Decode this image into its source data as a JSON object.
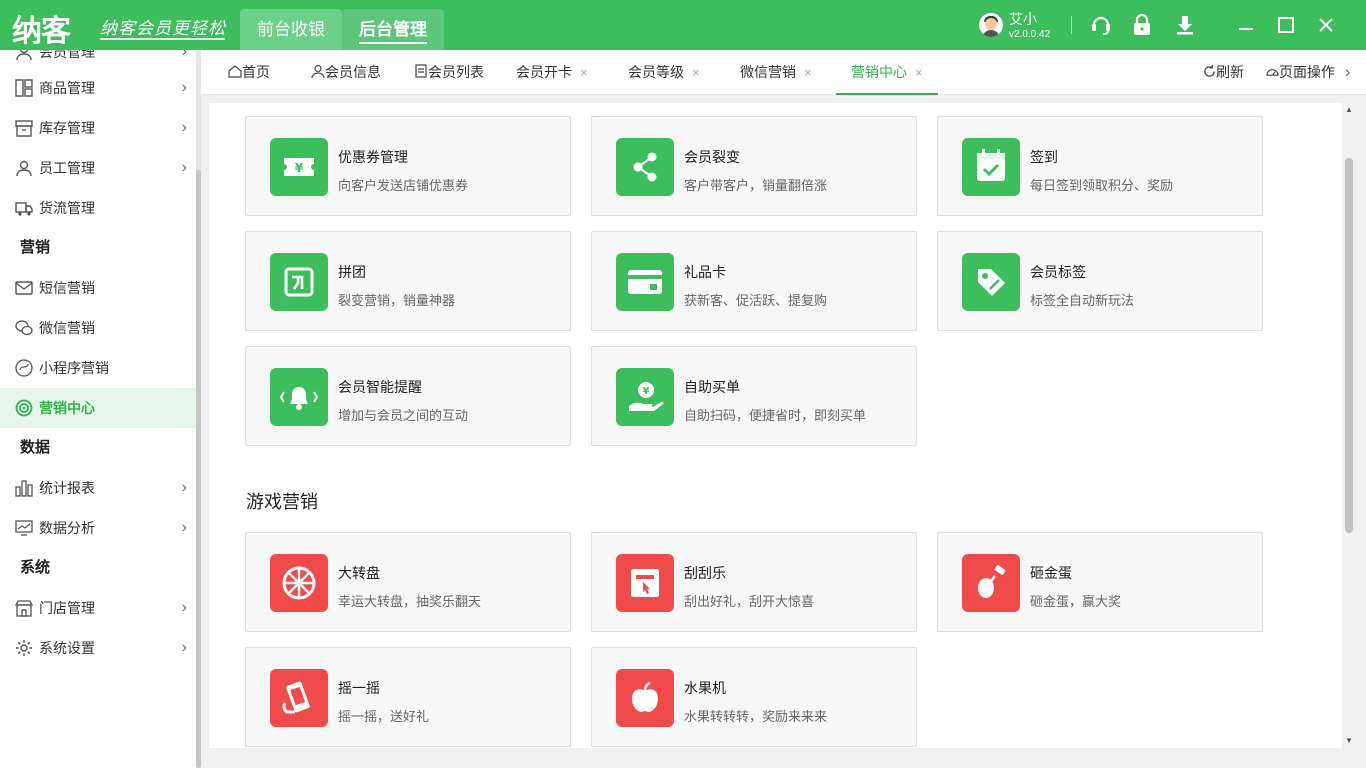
{
  "app": {
    "logo": "纳客",
    "slogan": "纳客会员更轻松",
    "nav": [
      "前台收银",
      "后台管理"
    ],
    "user_name": "艾小",
    "version": "v2.0.0.42",
    "brand_color": "#3dbd5c"
  },
  "sidebar": {
    "items": [
      {
        "label": "会员管理",
        "icon": "member-icon",
        "arrow": "›"
      },
      {
        "label": "商品管理",
        "icon": "goods-icon",
        "arrow": "›"
      },
      {
        "label": "库存管理",
        "icon": "inventory-icon",
        "arrow": "›"
      },
      {
        "label": "员工管理",
        "icon": "staff-icon",
        "arrow": "›"
      },
      {
        "label": "货流管理",
        "icon": "truck-icon"
      }
    ],
    "group_marketing": "营销",
    "marketing_items": [
      {
        "label": "短信营销",
        "icon": "mail-icon"
      },
      {
        "label": "微信营销",
        "icon": "wechat-icon"
      },
      {
        "label": "小程序营销",
        "icon": "miniprogram-icon"
      },
      {
        "label": "营销中心",
        "icon": "target-icon",
        "active": true
      }
    ],
    "group_data": "数据",
    "data_items": [
      {
        "label": "统计报表",
        "icon": "bar-chart-icon",
        "arrow": "›"
      },
      {
        "label": "数据分析",
        "icon": "line-chart-icon",
        "arrow": "›"
      }
    ],
    "group_system": "系统",
    "system_items": [
      {
        "label": "门店管理",
        "icon": "store-icon",
        "arrow": "›"
      },
      {
        "label": "系统设置",
        "icon": "gear-icon",
        "arrow": "›"
      }
    ]
  },
  "tabs": [
    {
      "label": "首页",
      "icon": "home-icon"
    },
    {
      "label": "会员信息",
      "icon": "person-icon"
    },
    {
      "label": "会员列表",
      "icon": "list-icon"
    },
    {
      "label": "会员开卡",
      "close": "×"
    },
    {
      "label": "会员等级",
      "close": "×"
    },
    {
      "label": "微信营销",
      "close": "×"
    },
    {
      "label": "营销中心",
      "close": "×",
      "active": true
    }
  ],
  "tab_actions": {
    "refresh": "刷新",
    "page_ops": "页面操作",
    "more": "›"
  },
  "marketing_cards": [
    {
      "title": "优惠券管理",
      "desc": "向客户发送店铺优惠券",
      "icon": "coupon-icon"
    },
    {
      "title": "会员裂变",
      "desc": "客户带客户，销量翻倍涨",
      "icon": "share-icon"
    },
    {
      "title": "签到",
      "desc": "每日签到领取积分、奖励",
      "icon": "calendar-check-icon"
    },
    {
      "title": "拼团",
      "desc": "裂变营销，销量神器",
      "icon": "group-buy-icon"
    },
    {
      "title": "礼品卡",
      "desc": "获新客、促活跃、提复购",
      "icon": "gift-card-icon"
    },
    {
      "title": "会员标签",
      "desc": "标签全自动新玩法",
      "icon": "tag-icon"
    },
    {
      "title": "会员智能提醒",
      "desc": "增加与会员之间的互动",
      "icon": "bell-icon"
    },
    {
      "title": "自助买单",
      "desc": "自助扫码，便捷省时，即刻买单",
      "icon": "self-pay-icon"
    }
  ],
  "game_section_title": "游戏营销",
  "game_cards": [
    {
      "title": "大转盘",
      "desc": "幸运大转盘，抽奖乐翻天",
      "icon": "wheel-icon"
    },
    {
      "title": "刮刮乐",
      "desc": "刮出好礼，刮开大惊喜",
      "icon": "scratch-icon"
    },
    {
      "title": "砸金蛋",
      "desc": "砸金蛋，赢大奖",
      "icon": "egg-hammer-icon"
    },
    {
      "title": "摇一摇",
      "desc": "摇一摇，送好礼",
      "icon": "shake-icon"
    },
    {
      "title": "水果机",
      "desc": "水果转转转，奖励来来来",
      "icon": "apple-icon"
    }
  ]
}
